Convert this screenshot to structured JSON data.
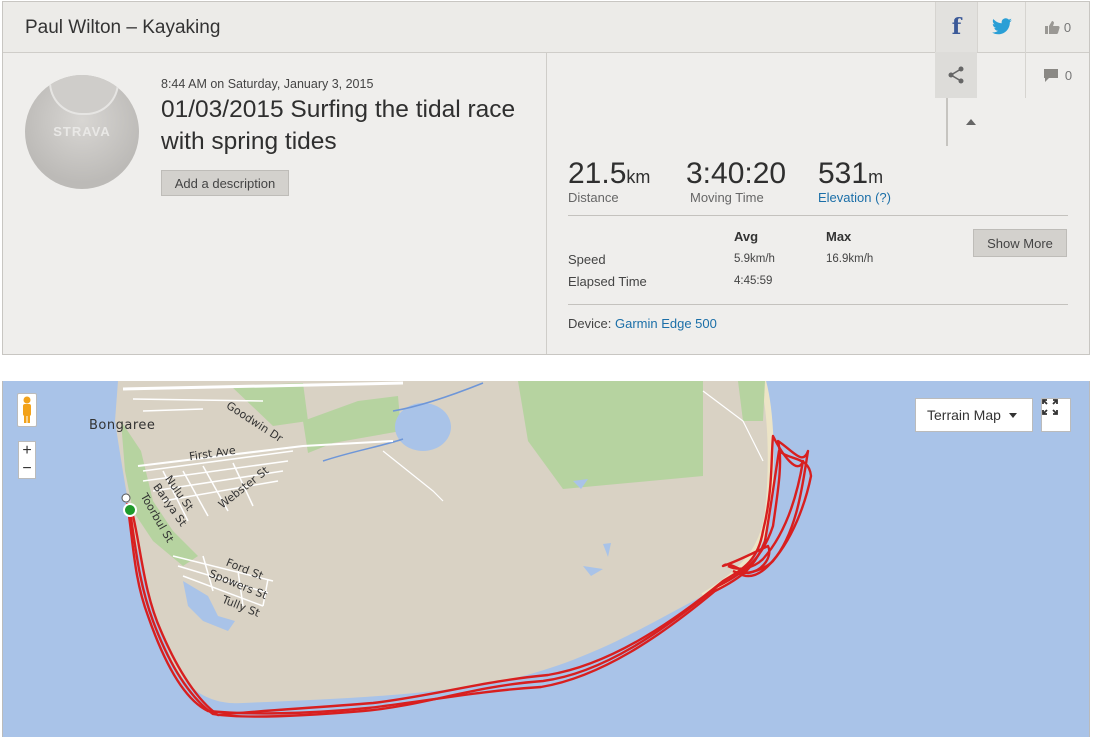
{
  "header": {
    "title": "Paul Wilton – Kayaking",
    "likes": "0",
    "comments": "0"
  },
  "activity": {
    "datetime": "8:44 AM on Saturday, January 3, 2015",
    "title": "01/03/2015 Surfing the tidal race with spring tides",
    "add_description": "Add a description",
    "avatar_text": "STRAVA"
  },
  "stats": {
    "distance_value": "21.5",
    "distance_unit": "km",
    "distance_label": "Distance",
    "moving_time_value": "3:40:20",
    "moving_time_label": "Moving Time",
    "elevation_value": "531",
    "elevation_unit": "m",
    "elevation_label": "Elevation (?)"
  },
  "details": {
    "col_avg": "Avg",
    "col_max": "Max",
    "speed_label": "Speed",
    "speed_avg": "5.9km/h",
    "speed_max": "16.9km/h",
    "elapsed_label": "Elapsed Time",
    "elapsed_avg": "4:45:59",
    "show_more": "Show More",
    "device_label": "Device:",
    "device_name": "Garmin Edge 500"
  },
  "map": {
    "type_button": "Terrain Map",
    "zoom_in": "+",
    "zoom_out": "−",
    "labels": {
      "town": "Bongaree",
      "goodwin": "Goodwin Dr",
      "first_ave": "First Ave",
      "nulu": "Nulu St",
      "banya": "Banya St",
      "webster": "Webster St",
      "toorbul": "Toorbul St",
      "ford": "Ford St",
      "spowers": "Spowers St",
      "tully": "Tully St"
    }
  },
  "colors": {
    "water": "#a9c3e8",
    "land": "#d9d2c4",
    "park": "#b6d3a0",
    "route": "#d81f1f",
    "link": "#1b6fa8",
    "start_marker": "#1f9a2b"
  },
  "icons": [
    "facebook-icon",
    "twitter-icon",
    "thumbs-up-icon",
    "share-icon",
    "comment-icon",
    "pegman-icon",
    "fullscreen-icon"
  ]
}
